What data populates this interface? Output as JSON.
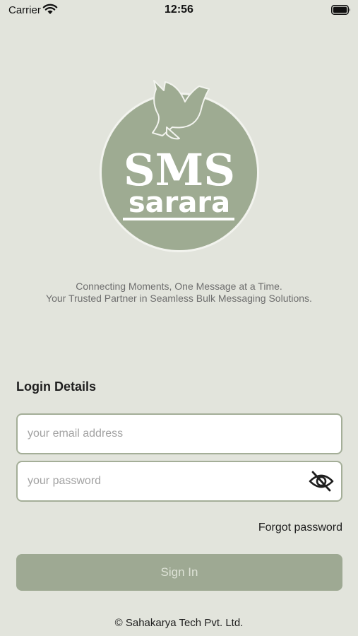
{
  "status_bar": {
    "carrier": "Carrier",
    "time": "12:56",
    "wifi_icon": "wifi-icon",
    "battery_icon": "battery-icon"
  },
  "logo": {
    "line1": "SMS",
    "line2": "sarara",
    "icon": "dove-icon",
    "color": "#9eab92"
  },
  "tagline": {
    "line1": "Connecting Moments, One Message at a Time.",
    "line2": "Your Trusted Partner in Seamless Bulk Messaging Solutions."
  },
  "login": {
    "title": "Login Details",
    "email_placeholder": "your email address",
    "email_value": "",
    "password_placeholder": "your password",
    "password_value": "",
    "password_toggle_icon": "eye-off-icon",
    "forgot_label": "Forgot password",
    "sign_in_label": "Sign In"
  },
  "footer": {
    "copyright": "© Sahakarya Tech Pvt. Ltd."
  },
  "colors": {
    "background": "#e2e4dc",
    "accent": "#9ea993",
    "field_border": "#a4ae98"
  }
}
